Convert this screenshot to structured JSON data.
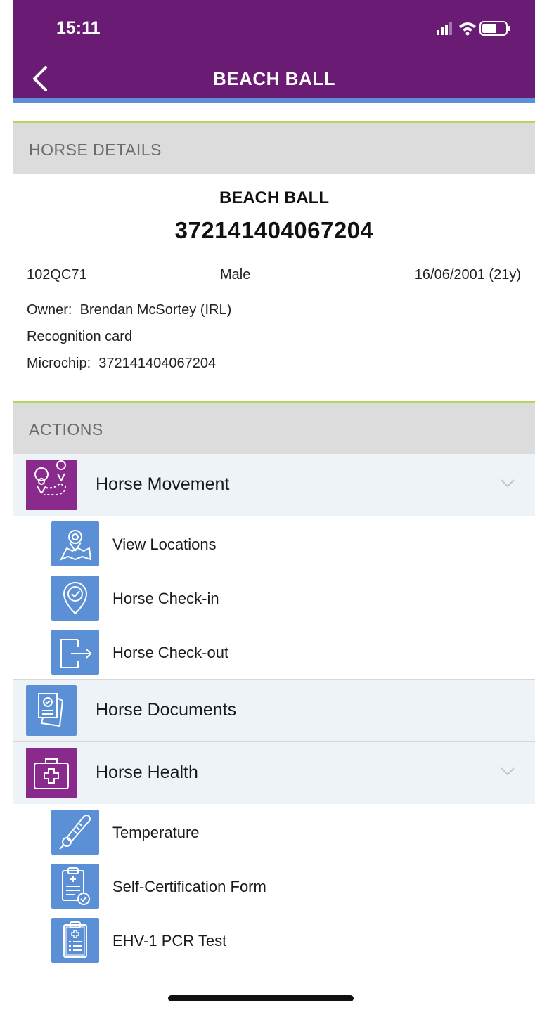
{
  "status_bar": {
    "time": "15:11"
  },
  "header": {
    "title": "BEACH BALL"
  },
  "horse_details": {
    "section_label": "HORSE DETAILS",
    "name": "BEACH BALL",
    "ueln": "372141404067204",
    "code": "102QC71",
    "sex": "Male",
    "dob": "16/06/2001 (21y)",
    "owner_label": "Owner:",
    "owner_value": "Brendan McSortey (IRL)",
    "recognition": "Recognition card",
    "microchip_label": "Microchip:",
    "microchip_value": "372141404067204"
  },
  "actions": {
    "section_label": "ACTIONS",
    "movement": {
      "label": "Horse Movement",
      "icon": "location-route-icon",
      "items": [
        {
          "label": "View Locations",
          "icon": "map-pin-icon"
        },
        {
          "label": "Horse Check-in",
          "icon": "check-pin-icon"
        },
        {
          "label": "Horse Check-out",
          "icon": "exit-icon"
        }
      ]
    },
    "documents": {
      "label": "Horse Documents",
      "icon": "documents-icon"
    },
    "health": {
      "label": "Horse Health",
      "icon": "medical-kit-icon",
      "items": [
        {
          "label": "Temperature",
          "icon": "thermometer-icon"
        },
        {
          "label": "Self-Certification Form",
          "icon": "certified-form-icon"
        },
        {
          "label": "EHV-1 PCR Test",
          "icon": "clipboard-medical-icon"
        }
      ]
    }
  },
  "colors": {
    "header": "#6a1b74",
    "accent_blue": "#5b8fd6",
    "accent_purple": "#8a2a8c",
    "section_border": "#b5d65a"
  }
}
